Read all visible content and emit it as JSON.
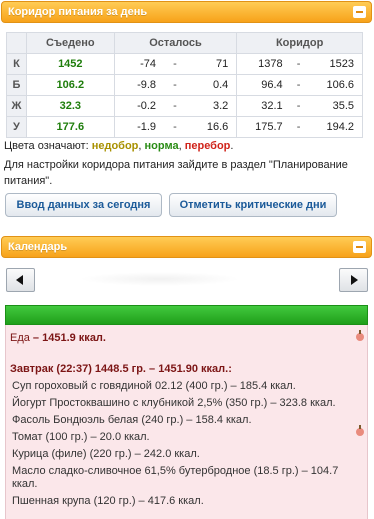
{
  "corridor": {
    "title": "Коридор питания за день",
    "headers": {
      "eaten": "Съедено",
      "left": "Осталось",
      "corridor": "Коридор"
    },
    "rows": [
      {
        "letter": "К",
        "eaten": "1452",
        "left_from": "-74",
        "left_to": "71",
        "corr_from": "1378",
        "corr_to": "1523"
      },
      {
        "letter": "Б",
        "eaten": "106.2",
        "left_from": "-9.8",
        "left_to": "0.4",
        "corr_from": "96.4",
        "corr_to": "106.6"
      },
      {
        "letter": "Ж",
        "eaten": "32.3",
        "left_from": "-0.2",
        "left_to": "3.2",
        "corr_from": "32.1",
        "corr_to": "35.5"
      },
      {
        "letter": "У",
        "eaten": "177.6",
        "left_from": "-1.9",
        "left_to": "16.6",
        "corr_from": "175.7",
        "corr_to": "194.2"
      }
    ],
    "separator": "-",
    "legend": {
      "prefix": "Цвета означают: ",
      "nedobor": "недобор",
      "comma1": ", ",
      "norma": "норма",
      "comma2": ", ",
      "perebor": "перебор",
      "suffix": "."
    },
    "hint": "Для настройки коридора питания зайдите в раздел \"Планирование питания\".",
    "buttons": {
      "enter_today": "Ввод данных за сегодня",
      "mark_critical": "Отметить критические дни"
    }
  },
  "calendar": {
    "title": "Календарь",
    "day": {
      "summary_label": "Еда",
      "summary_value": " – 1451.9 ккал.",
      "meal_title": "Завтрак (22:37) 1448.5 гр. – 1451.90 ккал.:",
      "items": [
        "Суп гороховый с говядиной 02.12 (400 гр.) – 185.4 ккал.",
        "Йогурт Простоквашино с клубникой 2,5% (350 гр.) – 323.8 ккал.",
        "Фасоль Бондюэль белая (240 гр.) – 158.4 ккал.",
        "Томат (100 гр.) – 20.0 ккал.",
        "Курица (филе) (220 гр.) – 242.0 ккал.",
        "Масло сладко-сливочное 61,5% бутербродное (18.5 гр.) – 104.7",
        "ккал.",
        "Пшенная крупа (120 гр.) – 417.6 ккал."
      ]
    }
  },
  "colors": {
    "header_orange": "#f7a21a",
    "nedobor": "#a89100",
    "norma": "#2a8c15",
    "perebor": "#d0231a",
    "bar_green": "#1f9f1a",
    "day_bg": "#fbe7ea"
  },
  "icons": [
    "collapse-icon",
    "arrow-left-icon",
    "arrow-right-icon",
    "apple-icon"
  ]
}
